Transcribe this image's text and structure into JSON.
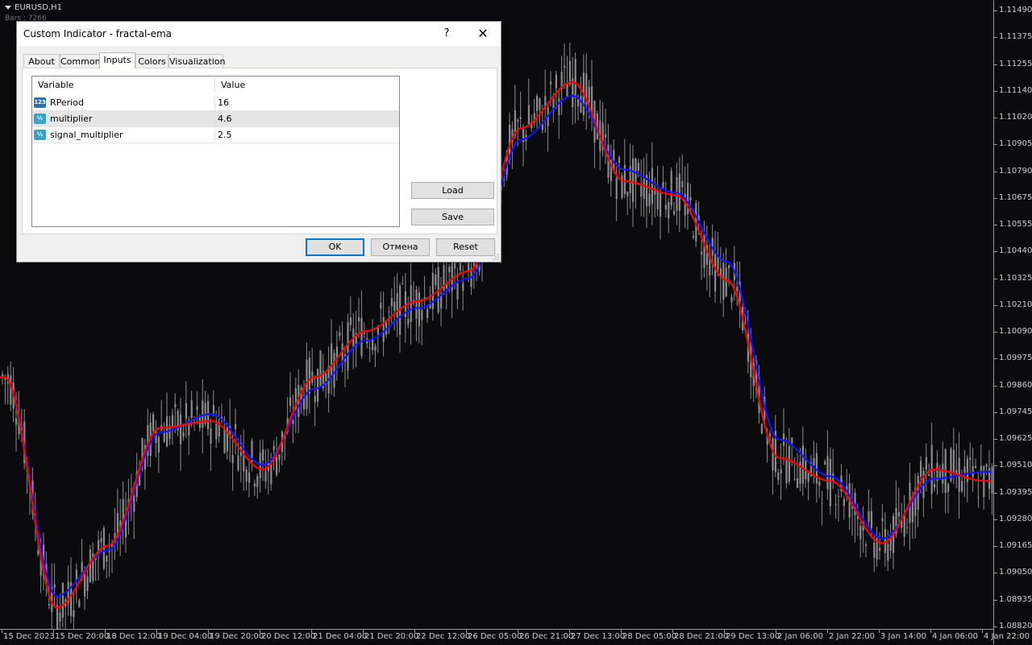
{
  "chart": {
    "symbol": "EURUSD,H1",
    "bars_info": "Bars : 7266",
    "background": "#0b0b0e",
    "candle_color": "#8c8c8c",
    "fast_line_color": "#ff0000",
    "slow_line_color": "#1414ff",
    "price_labels": [
      "1.11490",
      "1.11375",
      "1.11255",
      "1.11140",
      "1.11020",
      "1.10905",
      "1.10790",
      "1.10675",
      "1.10555",
      "1.10440",
      "1.10325",
      "1.10210",
      "1.10090",
      "1.09975",
      "1.09860",
      "1.09745",
      "1.09625",
      "1.09510",
      "1.09395",
      "1.09280",
      "1.09165",
      "1.09050",
      "1.08935",
      "1.08820"
    ],
    "time_labels": [
      "15 Dec 2023",
      "15 Dec 20:00",
      "18 Dec 12:00",
      "19 Dec 04:00",
      "19 Dec 20:00",
      "20 Dec 12:00",
      "21 Dec 04:00",
      "21 Dec 20:00",
      "22 Dec 12:00",
      "26 Dec 05:00",
      "26 Dec 21:00",
      "27 Dec 13:00",
      "28 Dec 05:00",
      "28 Dec 21:00",
      "29 Dec 13:00",
      "2 Jan 06:00",
      "2 Jan 22:00",
      "3 Jan 14:00",
      "4 Jan 06:00",
      "4 Jan 22:00"
    ]
  },
  "chart_data": {
    "type": "line",
    "xlabel": "",
    "ylabel": "",
    "ylim": [
      1.0882,
      1.1149
    ],
    "x": [
      "15 Dec 2023",
      "15 Dec 20:00",
      "18 Dec 12:00",
      "19 Dec 04:00",
      "19 Dec 20:00",
      "20 Dec 12:00",
      "21 Dec 04:00",
      "21 Dec 20:00",
      "22 Dec 12:00",
      "26 Dec 05:00",
      "26 Dec 21:00",
      "27 Dec 13:00",
      "28 Dec 05:00",
      "28 Dec 21:00",
      "29 Dec 13:00",
      "2 Jan 06:00",
      "2 Jan 22:00",
      "3 Jan 14:00",
      "4 Jan 06:00",
      "4 Jan 22:00"
    ],
    "series": [
      {
        "values": [
          1.099,
          1.089,
          1.0917,
          1.0968,
          1.0971,
          1.095,
          1.099,
          1.101,
          1.1023,
          1.1036,
          1.1098,
          1.1118,
          1.1075,
          1.1069,
          1.1032,
          1.0955,
          1.0945,
          1.0918,
          1.095,
          1.0945
        ]
      },
      {
        "values": [
          1.099,
          1.0895,
          1.0915,
          1.0966,
          1.0974,
          1.0952,
          1.0985,
          1.1006,
          1.102,
          1.1033,
          1.1093,
          1.1112,
          1.108,
          1.107,
          1.104,
          1.0963,
          1.0947,
          1.092,
          1.0946,
          1.0949
        ]
      }
    ]
  },
  "dialog": {
    "title": "Custom Indicator - fractal-ema",
    "help": "?",
    "close": "✕",
    "tabs": [
      "About",
      "Common",
      "Inputs",
      "Colors",
      "Visualization"
    ],
    "active_tab": "Inputs",
    "table": {
      "headers": [
        "Variable",
        "Value"
      ],
      "rows": [
        {
          "icon": "123",
          "name": "RPeriod",
          "value": "16"
        },
        {
          "icon": "½",
          "name": "multiplier",
          "value": "4.6"
        },
        {
          "icon": "½",
          "name": "signal_multiplier",
          "value": "2.5"
        }
      ]
    },
    "load": "Load",
    "save": "Save",
    "ok": "OK",
    "cancel": "Отмена",
    "reset": "Reset"
  }
}
